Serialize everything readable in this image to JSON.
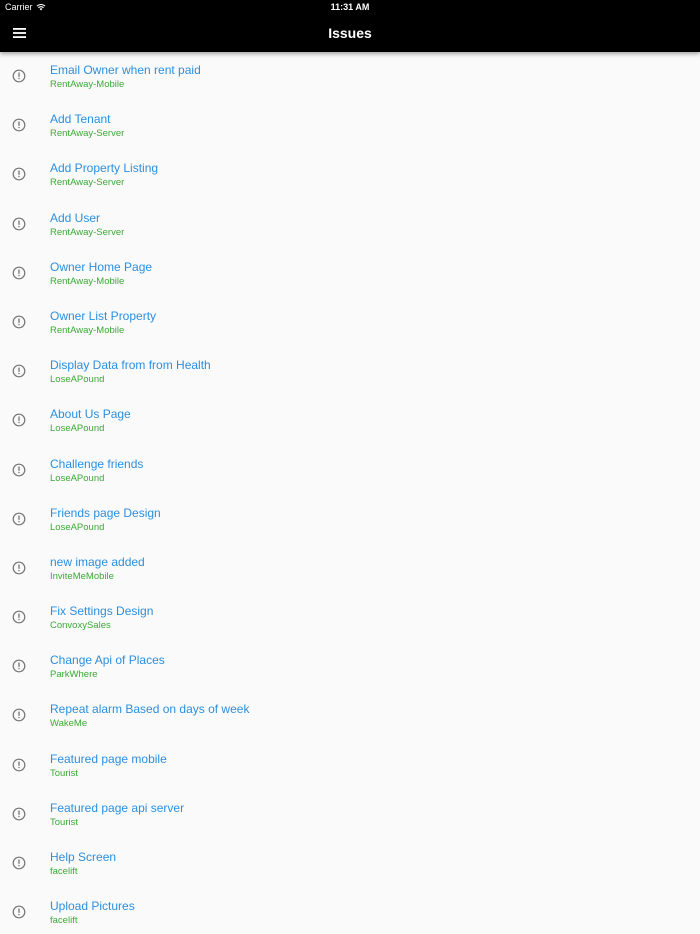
{
  "status_bar": {
    "carrier": "Carrier",
    "time": "11:31 AM"
  },
  "app_bar": {
    "title": "Issues",
    "menu_icon": "hamburger-menu-icon"
  },
  "colors": {
    "issue_title": "#2a8fe0",
    "project_name": "#3aaa35",
    "app_bar": "#000000",
    "background": "#fafafa"
  },
  "issues": [
    {
      "title": "Email Owner when rent paid",
      "project": "RentAway-Mobile"
    },
    {
      "title": "Add Tenant",
      "project": "RentAway-Server"
    },
    {
      "title": "Add Property Listing",
      "project": "RentAway-Server"
    },
    {
      "title": "Add User",
      "project": "RentAway-Server"
    },
    {
      "title": "Owner Home Page",
      "project": "RentAway-Mobile"
    },
    {
      "title": "Owner List Property",
      "project": "RentAway-Mobile"
    },
    {
      "title": "Display Data from from Health",
      "project": "LoseAPound"
    },
    {
      "title": "About Us Page",
      "project": "LoseAPound"
    },
    {
      "title": "Challenge friends",
      "project": "LoseAPound"
    },
    {
      "title": "Friends page Design",
      "project": "LoseAPound"
    },
    {
      "title": "new image added",
      "project": "InviteMeMobile"
    },
    {
      "title": "Fix Settings Design",
      "project": "ConvoxySales"
    },
    {
      "title": "Change Api of Places",
      "project": "ParkWhere"
    },
    {
      "title": "Repeat alarm Based on days of week",
      "project": "WakeMe"
    },
    {
      "title": "Featured page mobile",
      "project": "Tourist"
    },
    {
      "title": "Featured page api server",
      "project": "Tourist"
    },
    {
      "title": "Help Screen",
      "project": "facelift"
    },
    {
      "title": "Upload Pictures",
      "project": "facelift"
    }
  ]
}
